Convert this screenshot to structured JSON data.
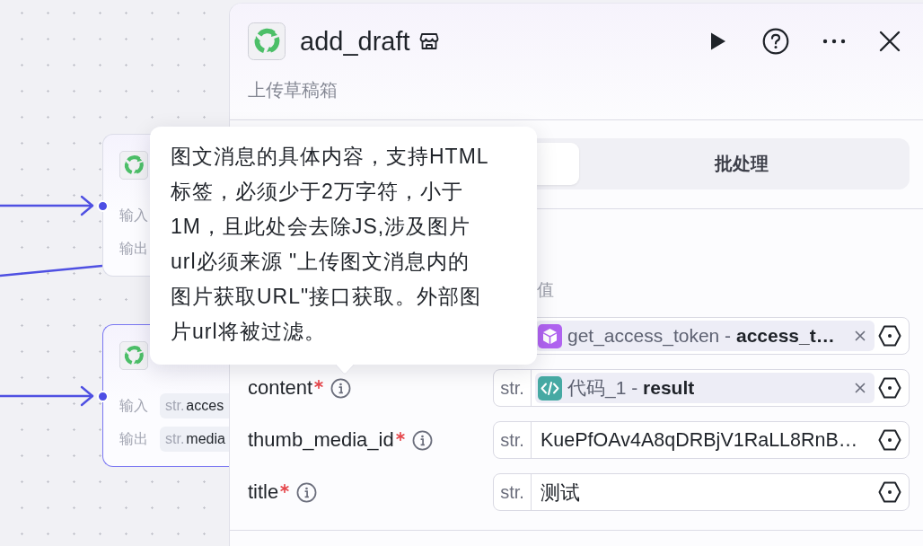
{
  "canvas": {
    "nodes": [
      {
        "selected": false,
        "rows": [
          {
            "label": "输入"
          },
          {
            "label": "输出"
          }
        ]
      },
      {
        "selected": true,
        "rows": [
          {
            "label": "输入",
            "type": "str.",
            "value": "acces"
          },
          {
            "label": "输出",
            "type": "str.",
            "value": "media"
          }
        ]
      }
    ]
  },
  "node_panel": {
    "title": "add_draft",
    "description": "上传草稿箱",
    "tabs": [
      {
        "selected": true
      },
      {
        "label": "批处理",
        "selected": false
      }
    ],
    "inputs": {
      "value_header": "值",
      "params": [
        {
          "value": {
            "kind": "plugin",
            "text": "get_access_token - **access_t…**"
          }
        },
        {
          "name": "content",
          "required": true,
          "type": "str.",
          "value": {
            "kind": "code",
            "text": "代码_1 - **result**"
          }
        },
        {
          "name": "thumb_media_id",
          "required": true,
          "type": "str.",
          "value": {
            "kind": "literal",
            "text": "KuePfOAv4A8qDRBjV1RaLL8RnB…"
          }
        },
        {
          "name": "title",
          "required": true,
          "type": "str.",
          "value": {
            "kind": "literal",
            "text": "测试"
          }
        }
      ]
    }
  },
  "tooltip": {
    "text": "图文消息的具体内容，支持HTML标签，必须少于2万字符，小于1M，且此处会去除JS,涉及图片url必须来源 \"上传图文消息内的图片获取URL\"接口获取。外部图片url将被过滤。"
  }
}
